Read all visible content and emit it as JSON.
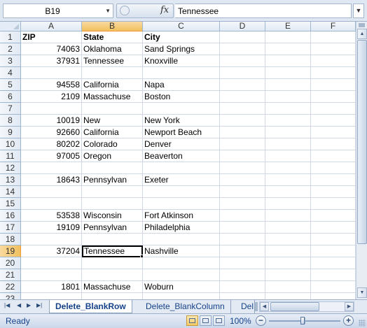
{
  "formula_bar": {
    "name_box": "B19",
    "fx_icon": "fx",
    "formula_value": "Tennessee"
  },
  "grid": {
    "columns": [
      "A",
      "B",
      "C",
      "D",
      "E",
      "F"
    ],
    "selected_column": "B",
    "selected_row": "19",
    "rows": [
      {
        "num": "1",
        "a": "ZIP",
        "b": "State",
        "c": "City",
        "header": true
      },
      {
        "num": "2",
        "a": "74063",
        "b": "Oklahoma",
        "c": "Sand Springs"
      },
      {
        "num": "3",
        "a": "37931",
        "b": "Tennessee",
        "c": "Knoxville"
      },
      {
        "num": "4",
        "a": "",
        "b": "",
        "c": ""
      },
      {
        "num": "5",
        "a": "94558",
        "b": "California",
        "c": "Napa"
      },
      {
        "num": "6",
        "a": "2109",
        "b": "Massachuse",
        "c": "Boston"
      },
      {
        "num": "7",
        "a": "",
        "b": "",
        "c": ""
      },
      {
        "num": "8",
        "a": "10019",
        "b": "New",
        "c": "New York"
      },
      {
        "num": "9",
        "a": "92660",
        "b": "California",
        "c": "Newport Beach"
      },
      {
        "num": "10",
        "a": "80202",
        "b": "Colorado",
        "c": "Denver"
      },
      {
        "num": "11",
        "a": "97005",
        "b": "Oregon",
        "c": "Beaverton"
      },
      {
        "num": "12",
        "a": "",
        "b": "",
        "c": ""
      },
      {
        "num": "13",
        "a": "18643",
        "b": "Pennsylvan",
        "c": "Exeter"
      },
      {
        "num": "14",
        "a": "",
        "b": "",
        "c": ""
      },
      {
        "num": "15",
        "a": "",
        "b": "",
        "c": ""
      },
      {
        "num": "16",
        "a": "53538",
        "b": "Wisconsin",
        "c": "Fort Atkinson"
      },
      {
        "num": "17",
        "a": "19109",
        "b": "Pennsylvan",
        "c": "Philadelphia"
      },
      {
        "num": "18",
        "a": "",
        "b": "",
        "c": ""
      },
      {
        "num": "19",
        "a": "37204",
        "b": "Tennessee",
        "c": "Nashville",
        "active": true
      },
      {
        "num": "20",
        "a": "",
        "b": "",
        "c": ""
      },
      {
        "num": "21",
        "a": "",
        "b": "",
        "c": ""
      },
      {
        "num": "22",
        "a": "1801",
        "b": "Massachuse",
        "c": "Woburn"
      },
      {
        "num": "23",
        "a": "",
        "b": "",
        "c": ""
      }
    ]
  },
  "sheet_tabs": {
    "nav_icons": [
      "first-sheet-icon",
      "prev-sheet-icon",
      "next-sheet-icon",
      "last-sheet-icon"
    ],
    "tabs": [
      "Delete_BlankRow",
      "Delete_BlankColumn",
      "Del"
    ],
    "active": "Delete_BlankRow"
  },
  "status_bar": {
    "status": "Ready",
    "zoom": "100%",
    "zoom_minus": "−",
    "zoom_plus": "+",
    "view_modes": [
      "normal-view-icon",
      "page-layout-view-icon",
      "page-break-preview-icon"
    ]
  },
  "colors": {
    "selection_header": "#f1c15f",
    "header_bg": "#e1e9f3",
    "gridline": "#d0d7e5",
    "tab_text": "#15428b"
  }
}
